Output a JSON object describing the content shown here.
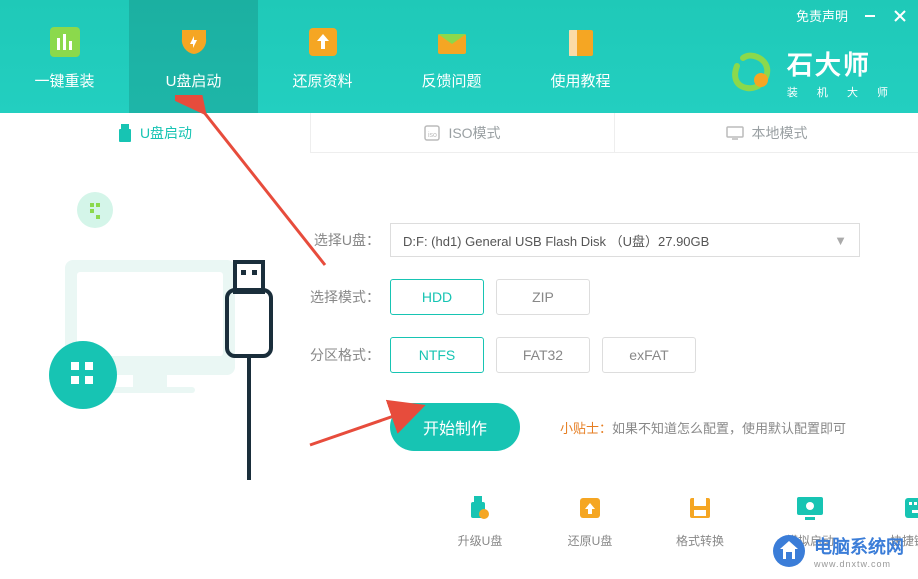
{
  "titlebar": {
    "disclaimer": "免责声明"
  },
  "logo": {
    "title": "石大师",
    "subtitle": "装 机 大 师"
  },
  "nav": {
    "items": [
      {
        "label": "一键重装"
      },
      {
        "label": "U盘启动"
      },
      {
        "label": "还原资料"
      },
      {
        "label": "反馈问题"
      },
      {
        "label": "使用教程"
      }
    ]
  },
  "subnav": {
    "items": [
      {
        "label": "U盘启动"
      },
      {
        "label": "ISO模式"
      },
      {
        "label": "本地模式"
      }
    ]
  },
  "form": {
    "usb_label": "选择U盘：",
    "usb_value": "D:F: (hd1) General USB Flash Disk （U盘）27.90GB",
    "mode_label": "选择模式：",
    "mode_options": [
      "HDD",
      "ZIP"
    ],
    "fs_label": "分区格式：",
    "fs_options": [
      "NTFS",
      "FAT32",
      "exFAT"
    ],
    "mode_selected": "HDD",
    "fs_selected": "NTFS"
  },
  "action": {
    "start": "开始制作",
    "tip_label": "小贴士：",
    "tip_text": "如果不知道怎么配置，使用默认配置即可"
  },
  "tools": [
    {
      "label": "升级U盘",
      "color": "#17c4b3"
    },
    {
      "label": "还原U盘",
      "color": "#f5a623"
    },
    {
      "label": "格式转换",
      "color": "#f5a623"
    },
    {
      "label": "模拟启动",
      "color": "#17c4b3"
    },
    {
      "label": "快捷键查询",
      "color": "#17c4b3"
    }
  ],
  "watermark": {
    "title": "电脑系统网",
    "url": "www.dnxtw.com"
  }
}
